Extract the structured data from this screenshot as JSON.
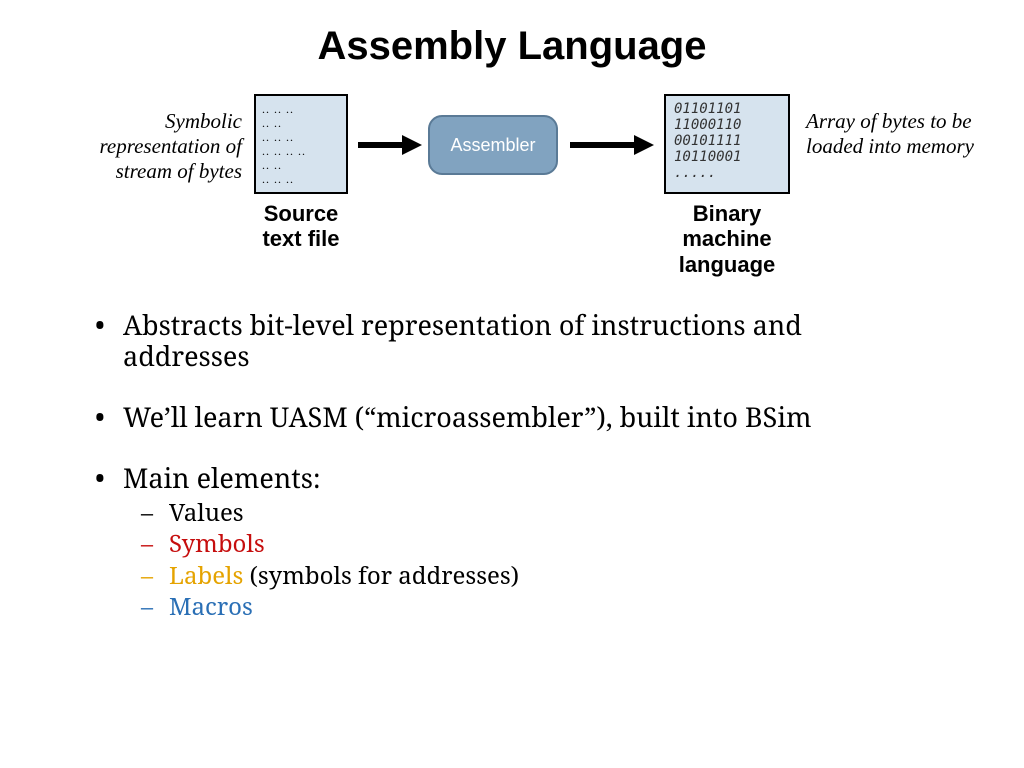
{
  "title": "Assembly Language",
  "diagram": {
    "left_caption": "Symbolic representation of stream of bytes",
    "right_caption": "Array of bytes to be loaded into memory",
    "assembler_label": "Assembler",
    "source_label_line1": "Source",
    "source_label_line2": "text file",
    "binary_label_line1": "Binary",
    "binary_label_line2": "machine",
    "binary_label_line3": "language",
    "binary_line1": "01101101",
    "binary_line2": "11000110",
    "binary_line3": "00101111",
    "binary_line4": "10110001",
    "binary_line5": "....."
  },
  "bullets": {
    "b1": "Abstracts bit-level representation of instructions and addresses",
    "b2": "We’ll learn UASM (“microassembler”), built into BSim",
    "b3": "Main elements:",
    "sub1": "Values",
    "sub2": "Symbols",
    "sub3_colored": "Labels",
    "sub3_rest": " (symbols for addresses)",
    "sub4": "Macros"
  },
  "colors": {
    "red": "#c60e0e",
    "orange": "#e5a300",
    "blue": "#2a6fb5"
  }
}
